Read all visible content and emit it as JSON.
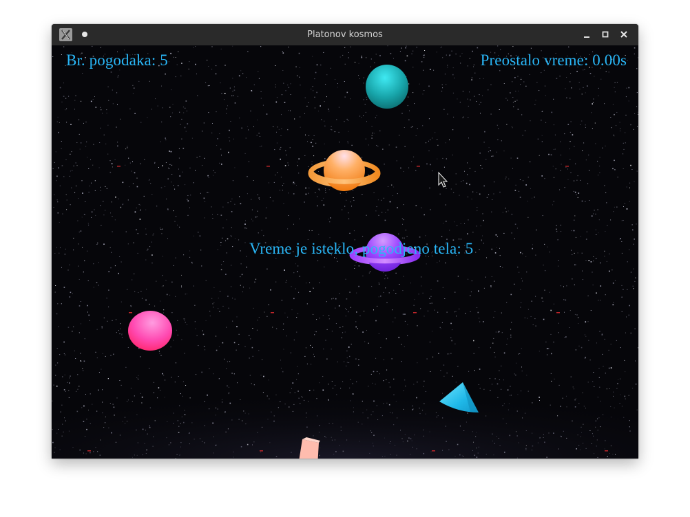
{
  "window": {
    "title": "Platonov kosmos",
    "icon": "x-app-icon",
    "buttons": [
      "minimize-icon",
      "maximize-icon",
      "close-icon"
    ]
  },
  "hud": {
    "hits_text": "Br. pogodaka: 5",
    "time_text": "Preostalo vreme: 0.00s",
    "message": "Vreme je isteklo, pogodjeno tela: 5"
  },
  "scene": {
    "bodies": [
      {
        "kind": "sphere",
        "color": "#1aa3a8"
      },
      {
        "kind": "ringed-planet",
        "color": "#ff9a3c"
      },
      {
        "kind": "ringed-planet",
        "color": "#a24dff"
      },
      {
        "kind": "sphere",
        "color": "#ff4da6"
      },
      {
        "kind": "cone",
        "color": "#22c7f0"
      },
      {
        "kind": "cube",
        "color": "#ffb8a8"
      }
    ],
    "cursor": "arrow-cursor-icon"
  },
  "colors": {
    "hud_text": "#29b6f6",
    "titlebar": "#2a2a2a",
    "background": "#06060a"
  }
}
